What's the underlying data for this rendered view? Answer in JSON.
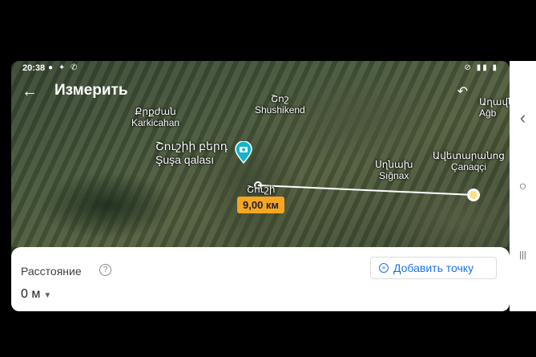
{
  "status_bar": {
    "time": "20:38",
    "left_icons": "● ✦ ✆",
    "right_icons": "⊘ ▮▮ ▮"
  },
  "header": {
    "back_icon": "←",
    "title": "Измерить",
    "undo_icon": "↶"
  },
  "map": {
    "labels": {
      "karkijahan_arm": "Քրքժան",
      "karkijahan": "Karkicahan",
      "shushikend_arm": "Շոշ",
      "shushikend": "Shushikend",
      "shusha_arm": "Շուշիի բերդ",
      "shusha": "Şuşa qalası",
      "shushi_city": "Շուշի",
      "signakh_arm": "Սղնախ",
      "signakh": "Sığnax",
      "avetaranots_arm": "Ավետարանոց",
      "chanakhchi": "Çanaqçi",
      "aghbulag_arm": "Աղավնո",
      "aghbulag": "Ağb"
    },
    "measured_distance": "9,00 км"
  },
  "bottom_sheet": {
    "distance_label": "Расстояние",
    "help_icon": "?",
    "add_point_label": "Добавить точку",
    "distance_value": "0 м"
  },
  "nav_bar": {
    "back_glyph": "‹",
    "home_glyph": "○",
    "recents_glyph": "|||"
  }
}
